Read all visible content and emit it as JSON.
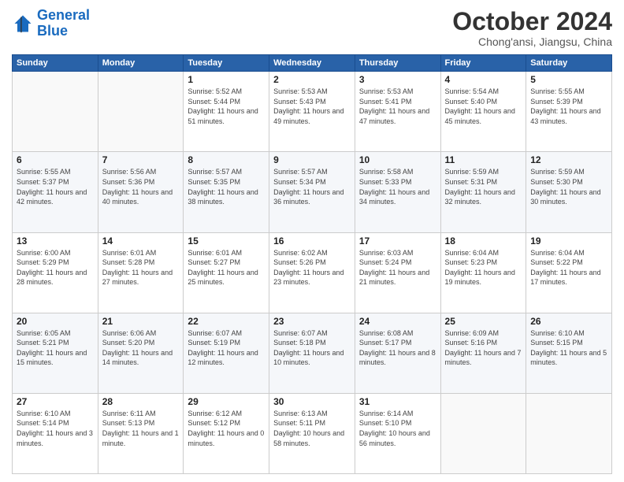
{
  "logo": {
    "line1": "General",
    "line2": "Blue"
  },
  "title": "October 2024",
  "subtitle": "Chong'ansi, Jiangsu, China",
  "header_days": [
    "Sunday",
    "Monday",
    "Tuesday",
    "Wednesday",
    "Thursday",
    "Friday",
    "Saturday"
  ],
  "weeks": [
    [
      {
        "day": "",
        "sunrise": "",
        "sunset": "",
        "daylight": ""
      },
      {
        "day": "",
        "sunrise": "",
        "sunset": "",
        "daylight": ""
      },
      {
        "day": "1",
        "sunrise": "Sunrise: 5:52 AM",
        "sunset": "Sunset: 5:44 PM",
        "daylight": "Daylight: 11 hours and 51 minutes."
      },
      {
        "day": "2",
        "sunrise": "Sunrise: 5:53 AM",
        "sunset": "Sunset: 5:43 PM",
        "daylight": "Daylight: 11 hours and 49 minutes."
      },
      {
        "day": "3",
        "sunrise": "Sunrise: 5:53 AM",
        "sunset": "Sunset: 5:41 PM",
        "daylight": "Daylight: 11 hours and 47 minutes."
      },
      {
        "day": "4",
        "sunrise": "Sunrise: 5:54 AM",
        "sunset": "Sunset: 5:40 PM",
        "daylight": "Daylight: 11 hours and 45 minutes."
      },
      {
        "day": "5",
        "sunrise": "Sunrise: 5:55 AM",
        "sunset": "Sunset: 5:39 PM",
        "daylight": "Daylight: 11 hours and 43 minutes."
      }
    ],
    [
      {
        "day": "6",
        "sunrise": "Sunrise: 5:55 AM",
        "sunset": "Sunset: 5:37 PM",
        "daylight": "Daylight: 11 hours and 42 minutes."
      },
      {
        "day": "7",
        "sunrise": "Sunrise: 5:56 AM",
        "sunset": "Sunset: 5:36 PM",
        "daylight": "Daylight: 11 hours and 40 minutes."
      },
      {
        "day": "8",
        "sunrise": "Sunrise: 5:57 AM",
        "sunset": "Sunset: 5:35 PM",
        "daylight": "Daylight: 11 hours and 38 minutes."
      },
      {
        "day": "9",
        "sunrise": "Sunrise: 5:57 AM",
        "sunset": "Sunset: 5:34 PM",
        "daylight": "Daylight: 11 hours and 36 minutes."
      },
      {
        "day": "10",
        "sunrise": "Sunrise: 5:58 AM",
        "sunset": "Sunset: 5:33 PM",
        "daylight": "Daylight: 11 hours and 34 minutes."
      },
      {
        "day": "11",
        "sunrise": "Sunrise: 5:59 AM",
        "sunset": "Sunset: 5:31 PM",
        "daylight": "Daylight: 11 hours and 32 minutes."
      },
      {
        "day": "12",
        "sunrise": "Sunrise: 5:59 AM",
        "sunset": "Sunset: 5:30 PM",
        "daylight": "Daylight: 11 hours and 30 minutes."
      }
    ],
    [
      {
        "day": "13",
        "sunrise": "Sunrise: 6:00 AM",
        "sunset": "Sunset: 5:29 PM",
        "daylight": "Daylight: 11 hours and 28 minutes."
      },
      {
        "day": "14",
        "sunrise": "Sunrise: 6:01 AM",
        "sunset": "Sunset: 5:28 PM",
        "daylight": "Daylight: 11 hours and 27 minutes."
      },
      {
        "day": "15",
        "sunrise": "Sunrise: 6:01 AM",
        "sunset": "Sunset: 5:27 PM",
        "daylight": "Daylight: 11 hours and 25 minutes."
      },
      {
        "day": "16",
        "sunrise": "Sunrise: 6:02 AM",
        "sunset": "Sunset: 5:26 PM",
        "daylight": "Daylight: 11 hours and 23 minutes."
      },
      {
        "day": "17",
        "sunrise": "Sunrise: 6:03 AM",
        "sunset": "Sunset: 5:24 PM",
        "daylight": "Daylight: 11 hours and 21 minutes."
      },
      {
        "day": "18",
        "sunrise": "Sunrise: 6:04 AM",
        "sunset": "Sunset: 5:23 PM",
        "daylight": "Daylight: 11 hours and 19 minutes."
      },
      {
        "day": "19",
        "sunrise": "Sunrise: 6:04 AM",
        "sunset": "Sunset: 5:22 PM",
        "daylight": "Daylight: 11 hours and 17 minutes."
      }
    ],
    [
      {
        "day": "20",
        "sunrise": "Sunrise: 6:05 AM",
        "sunset": "Sunset: 5:21 PM",
        "daylight": "Daylight: 11 hours and 15 minutes."
      },
      {
        "day": "21",
        "sunrise": "Sunrise: 6:06 AM",
        "sunset": "Sunset: 5:20 PM",
        "daylight": "Daylight: 11 hours and 14 minutes."
      },
      {
        "day": "22",
        "sunrise": "Sunrise: 6:07 AM",
        "sunset": "Sunset: 5:19 PM",
        "daylight": "Daylight: 11 hours and 12 minutes."
      },
      {
        "day": "23",
        "sunrise": "Sunrise: 6:07 AM",
        "sunset": "Sunset: 5:18 PM",
        "daylight": "Daylight: 11 hours and 10 minutes."
      },
      {
        "day": "24",
        "sunrise": "Sunrise: 6:08 AM",
        "sunset": "Sunset: 5:17 PM",
        "daylight": "Daylight: 11 hours and 8 minutes."
      },
      {
        "day": "25",
        "sunrise": "Sunrise: 6:09 AM",
        "sunset": "Sunset: 5:16 PM",
        "daylight": "Daylight: 11 hours and 7 minutes."
      },
      {
        "day": "26",
        "sunrise": "Sunrise: 6:10 AM",
        "sunset": "Sunset: 5:15 PM",
        "daylight": "Daylight: 11 hours and 5 minutes."
      }
    ],
    [
      {
        "day": "27",
        "sunrise": "Sunrise: 6:10 AM",
        "sunset": "Sunset: 5:14 PM",
        "daylight": "Daylight: 11 hours and 3 minutes."
      },
      {
        "day": "28",
        "sunrise": "Sunrise: 6:11 AM",
        "sunset": "Sunset: 5:13 PM",
        "daylight": "Daylight: 11 hours and 1 minute."
      },
      {
        "day": "29",
        "sunrise": "Sunrise: 6:12 AM",
        "sunset": "Sunset: 5:12 PM",
        "daylight": "Daylight: 11 hours and 0 minutes."
      },
      {
        "day": "30",
        "sunrise": "Sunrise: 6:13 AM",
        "sunset": "Sunset: 5:11 PM",
        "daylight": "Daylight: 10 hours and 58 minutes."
      },
      {
        "day": "31",
        "sunrise": "Sunrise: 6:14 AM",
        "sunset": "Sunset: 5:10 PM",
        "daylight": "Daylight: 10 hours and 56 minutes."
      },
      {
        "day": "",
        "sunrise": "",
        "sunset": "",
        "daylight": ""
      },
      {
        "day": "",
        "sunrise": "",
        "sunset": "",
        "daylight": ""
      }
    ]
  ]
}
